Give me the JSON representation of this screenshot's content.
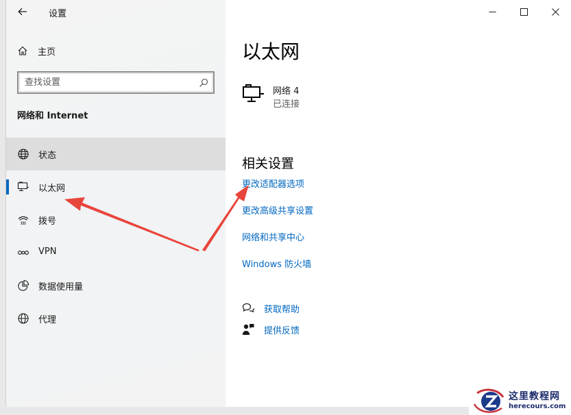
{
  "titlebar": {
    "app_title": "设置"
  },
  "sidebar": {
    "home_label": "主页",
    "search_placeholder": "查找设置",
    "section_title": "网络和 Internet",
    "items": [
      {
        "label": "状态",
        "icon": "globe-network-icon"
      },
      {
        "label": "以太网",
        "icon": "ethernet-monitor-icon",
        "selected": true
      },
      {
        "label": "拨号",
        "icon": "dialup-icon"
      },
      {
        "label": "VPN",
        "icon": "vpn-icon"
      },
      {
        "label": "数据使用量",
        "icon": "data-usage-icon"
      },
      {
        "label": "代理",
        "icon": "globe-icon"
      }
    ]
  },
  "main": {
    "page_title": "以太网",
    "network": {
      "name": "网络 4",
      "status": "已连接"
    },
    "related_title": "相关设置",
    "links": [
      "更改适配器选项",
      "更改高级共享设置",
      "网络和共享中心",
      "Windows 防火墙"
    ],
    "help": {
      "get_help": "获取帮助",
      "feedback": "提供反馈"
    }
  },
  "watermark": {
    "main": "这里教程网",
    "sub": "herecours.com"
  },
  "colors": {
    "accent": "#0067c0",
    "annotation_arrow": "#e8453c"
  }
}
